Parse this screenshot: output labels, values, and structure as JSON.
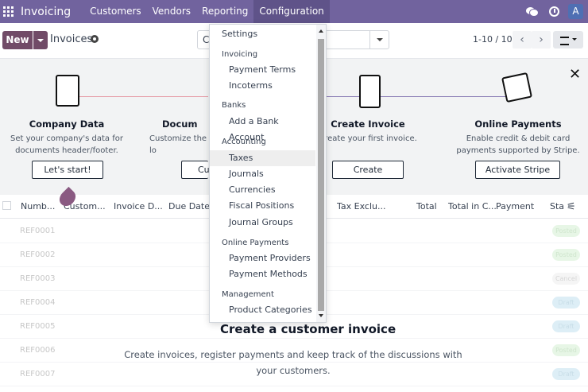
{
  "topbar": {
    "app_name": "Invoicing",
    "menu": [
      "Customers",
      "Vendors",
      "Reporting",
      "Configuration"
    ],
    "avatar": "A",
    "icons": [
      "apps-grid-icon",
      "chat-icon",
      "clock-icon"
    ]
  },
  "control": {
    "new_label": "New",
    "page_title": "Invoices",
    "search_partial": "C",
    "pager": "1-10 / 10",
    "pager_prev": "‹",
    "pager_next": "›"
  },
  "onboarding": {
    "close": "✕",
    "steps": [
      {
        "title": "Company Data",
        "desc": "Set your company's data for documents header/footer.",
        "button": "Let's start!"
      },
      {
        "title": "Docum",
        "desc": "Customize the lo",
        "button": "Cu"
      },
      {
        "title": "Create Invoice",
        "desc": "Create your first invoice.",
        "button": "Create"
      },
      {
        "title": "Online Payments",
        "desc": "Enable credit & debit card payments supported by Stripe.",
        "button": "Activate Stripe"
      }
    ]
  },
  "list": {
    "headers": [
      "Numb...",
      "Custom...",
      "Invoice D...",
      "Due Date",
      "Tax Exclu...",
      "Total",
      "Total in C...",
      "Payment",
      "Sta"
    ],
    "rows": [
      {
        "ref": "REF0001",
        "status": "Posted"
      },
      {
        "ref": "REF0002",
        "status": "Posted"
      },
      {
        "ref": "REF0003",
        "status": "Cancel"
      },
      {
        "ref": "REF0004",
        "status": "Draft"
      },
      {
        "ref": "REF0005",
        "status": "Draft"
      },
      {
        "ref": "REF0006",
        "status": "Posted"
      },
      {
        "ref": "REF0007",
        "status": "Draft"
      }
    ]
  },
  "empty": {
    "title": "Create a customer invoice",
    "text": "Create invoices, register payments and keep track of the discussions with your customers."
  },
  "dropdown": {
    "settings": "Settings",
    "sections": [
      {
        "heading": "Invoicing",
        "items": [
          "Payment Terms",
          "Incoterms"
        ]
      },
      {
        "heading": "Banks",
        "items": [
          "Add a Bank Account"
        ]
      },
      {
        "heading": "Accounting",
        "items": [
          "Taxes",
          "Journals",
          "Currencies",
          "Fiscal Positions",
          "Journal Groups"
        ]
      },
      {
        "heading": "Online Payments",
        "items": [
          "Payment Providers",
          "Payment Methods"
        ]
      },
      {
        "heading": "Management",
        "items": [
          "Product Categories"
        ]
      }
    ]
  }
}
